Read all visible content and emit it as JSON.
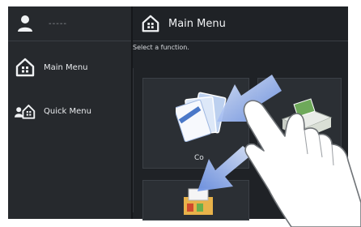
{
  "sidebar": {
    "user": {
      "name": "-----",
      "icon": "user-icon"
    },
    "items": [
      {
        "label": "Main Menu",
        "icon": "home-icon"
      },
      {
        "label": "Quick Menu",
        "icon": "quick-menu-icon"
      }
    ]
  },
  "header": {
    "title": "Main Menu",
    "icon": "home-icon"
  },
  "main": {
    "prompt": "Select a function.",
    "tiles": [
      {
        "label": "Co",
        "icon": "copy-icon"
      },
      {
        "label": "",
        "icon": "scanner-icon"
      },
      {
        "label": "",
        "icon": "print-icon"
      }
    ]
  },
  "gesture": {
    "type": "pinch",
    "icon": "hand-icon"
  },
  "colors": {
    "background": "#1f2226",
    "sidebar": "#26292d",
    "arrow": "#8fb0f0",
    "text": "#f1f3f5"
  }
}
